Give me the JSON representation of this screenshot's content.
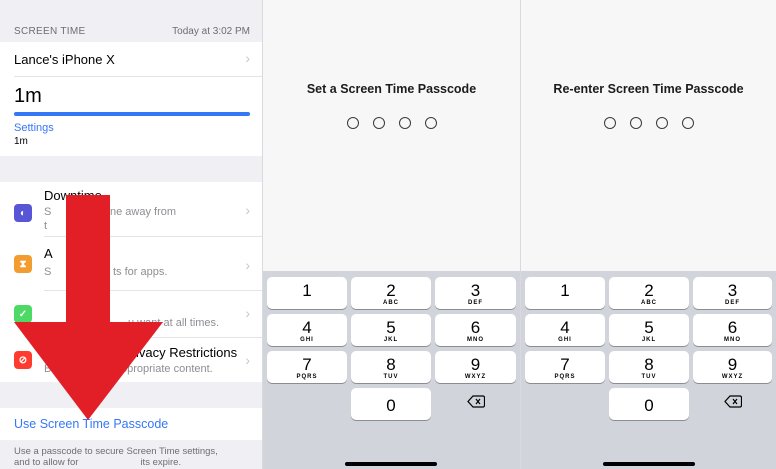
{
  "screen_time": {
    "header_label": "SCREEN TIME",
    "header_time": "Today at 3:02 PM",
    "device_name": "Lance's iPhone X",
    "usage_total": "1m",
    "category_label": "Settings",
    "category_value": "1m",
    "usage_fill_fraction": 1.0,
    "rows": [
      {
        "title": "Downtime",
        "subtitle_a": "S",
        "subtitle_b": "ne away from",
        "subtitle_c": "t",
        "icon": "moon-icon",
        "color": "#5856d6"
      },
      {
        "title": "A",
        "subtitle_a": "S",
        "subtitle_b": "ts for apps.",
        "icon": "hourglass-icon",
        "color": "#f39c2f"
      },
      {
        "title": "",
        "subtitle_a": "",
        "subtitle_b": "u want at all times.",
        "icon": "check-icon",
        "color": "#4cd964"
      },
      {
        "title": "Privacy Restrictions",
        "subtitle_a": "B",
        "subtitle_b": "opropriate content.",
        "icon": "restrict-icon",
        "color": "#ff3b30"
      }
    ],
    "passcode_link": "Use Screen Time Passcode",
    "footer_line1": "Use a passcode to secure Screen Time settings,",
    "footer_line2a": "and to allow for",
    "footer_line2b": "its expire.",
    "arrow_color": "#e21f26"
  },
  "set_passcode": {
    "title": "Set a Screen Time Passcode"
  },
  "reenter_passcode": {
    "title": "Re-enter Screen Time Passcode"
  },
  "keypad": {
    "keys": [
      {
        "num": "1",
        "letters": ""
      },
      {
        "num": "2",
        "letters": "ABC"
      },
      {
        "num": "3",
        "letters": "DEF"
      },
      {
        "num": "4",
        "letters": "GHI"
      },
      {
        "num": "5",
        "letters": "JKL"
      },
      {
        "num": "6",
        "letters": "MNO"
      },
      {
        "num": "7",
        "letters": "PQRS"
      },
      {
        "num": "8",
        "letters": "TUV"
      },
      {
        "num": "9",
        "letters": "WXYZ"
      },
      {
        "num": "0",
        "letters": ""
      }
    ],
    "delete_icon": "backspace-icon"
  }
}
